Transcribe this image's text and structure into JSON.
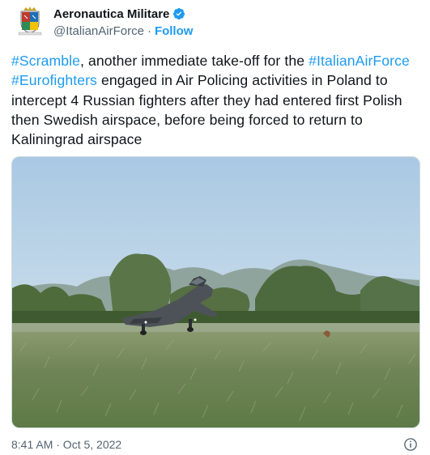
{
  "account": {
    "display_name": "Aeronautica Militare",
    "handle": "@ItalianAirForce",
    "separator": "·",
    "follow_label": "Follow"
  },
  "tweet": {
    "parts": [
      {
        "type": "hashtag",
        "text": "#Scramble"
      },
      {
        "type": "text",
        "text": ", another immediate take-off for the "
      },
      {
        "type": "hashtag",
        "text": "#ItalianAirForce"
      },
      {
        "type": "text",
        "text": " "
      },
      {
        "type": "hashtag",
        "text": "#Eurofighters"
      },
      {
        "type": "text",
        "text": " engaged in Air Policing activities in Poland to intercept 4 Russian fighters after they had entered first Polish then Swedish airspace, before being forced to return to Kaliningrad airspace"
      }
    ]
  },
  "footer": {
    "timestamp": "8:41 AM · Oct 5, 2022"
  },
  "icons": {
    "verified": "verified-badge-icon",
    "info": "info-icon",
    "avatar": "air-force-crest"
  },
  "colors": {
    "link": "#1d9bf0",
    "text": "#0f1419",
    "muted": "#536471"
  }
}
